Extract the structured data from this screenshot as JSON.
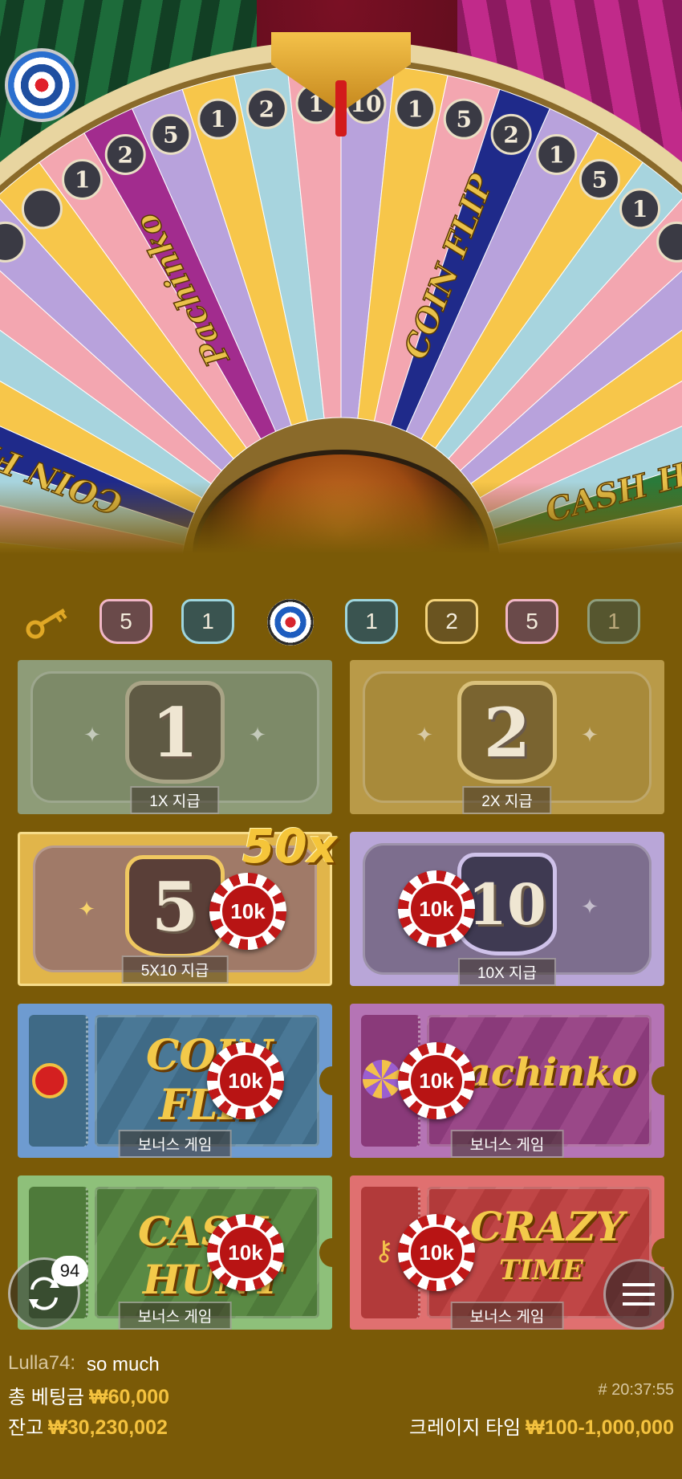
{
  "history": {
    "items": [
      {
        "label": "5",
        "border": "#f1b7c7",
        "fill": "#6a4a4a"
      },
      {
        "label": "1",
        "border": "#9fd6de",
        "fill": "#3a5450"
      },
      {
        "label": "",
        "type": "cash-hunt"
      },
      {
        "label": "1",
        "border": "#9fd6de",
        "fill": "#3a5450"
      },
      {
        "label": "2",
        "border": "#f3d27a",
        "fill": "#6a5420"
      },
      {
        "label": "5",
        "border": "#f1b7c7",
        "fill": "#6a4a4a"
      },
      {
        "label": "1",
        "border": "#9fd6de",
        "fill": "#3a5450"
      }
    ]
  },
  "wheel": {
    "segments": [
      "1",
      "2",
      "5",
      "1",
      "2",
      "1",
      "10",
      "1",
      "5",
      "2",
      "1",
      "5",
      "1"
    ],
    "bonus_labels": [
      "COIN FLIP",
      "Pachinko",
      "COIN FLIP",
      "CASH HUNT"
    ]
  },
  "bets": {
    "one": {
      "number": "1",
      "label": "1X 지급"
    },
    "two": {
      "number": "2",
      "label": "2X 지급"
    },
    "five": {
      "number": "5",
      "label": "5X10 지급",
      "multiplier": "50x"
    },
    "ten": {
      "number": "10",
      "label": "10X 지급"
    },
    "coin_flip": {
      "title_line1": "COIN",
      "title_line2": "FLIP",
      "label": "보너스 게임"
    },
    "pachinko": {
      "title": "Pachinko",
      "label": "보너스 게임"
    },
    "cash_hunt": {
      "title_line1": "CASH",
      "title_line2": "HUNT",
      "label": "보너스 게임"
    },
    "crazy_time": {
      "title_line1": "CRAZY",
      "title_line2": "TIME",
      "label": "보너스 게임"
    }
  },
  "chip_value": "10k",
  "replay": {
    "count": "94"
  },
  "chat": {
    "user": "Lulla74:",
    "message": "so much"
  },
  "footer": {
    "total_bet_label": "총 베팅금",
    "total_bet_value": "₩60,000",
    "balance_label": "잔고",
    "balance_value": "₩30,230,002",
    "time": "# 20:37:55",
    "game_label": "크레이지 타임",
    "limits_value": "₩100-1,000,000"
  },
  "colors": {
    "background": "#7a5a07",
    "accent_gold": "#f4c23e",
    "chip_red": "#c01818"
  }
}
